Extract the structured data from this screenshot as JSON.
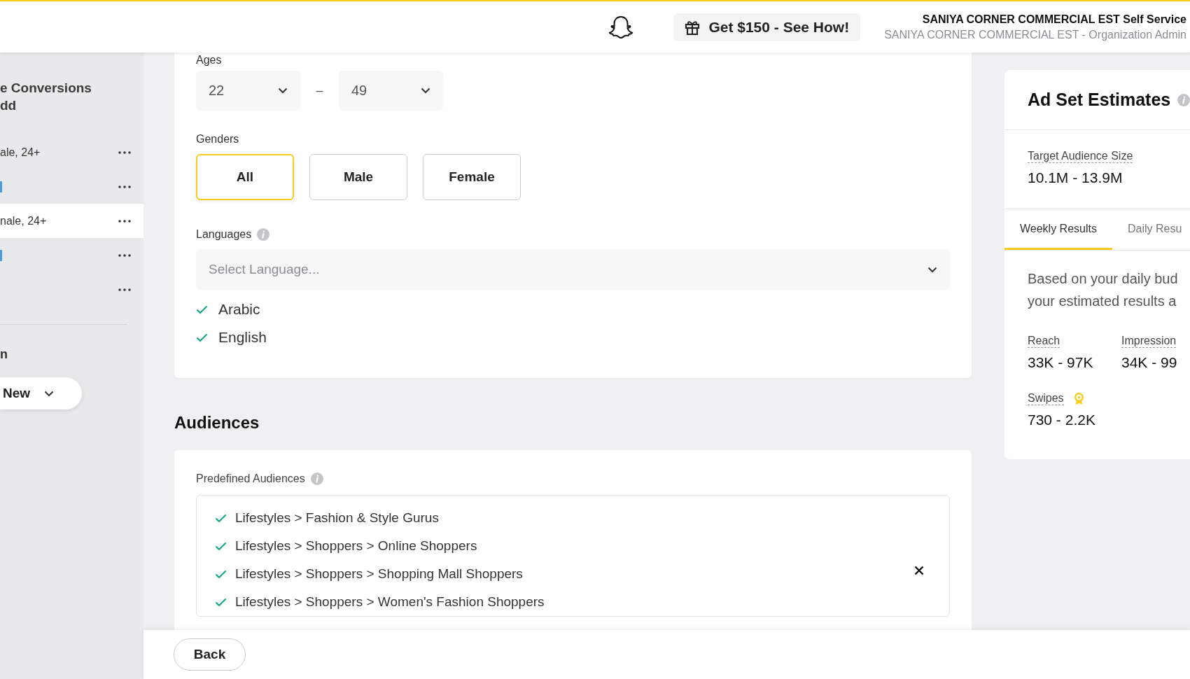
{
  "header": {
    "promo_button": "Get $150 - See How!",
    "account_name": "SANIYA CORNER COMMERCIAL EST Self Service",
    "account_role": "SANIYA CORNER COMMERCIAL EST - Organization Admin"
  },
  "sidebar": {
    "campaign_title": [
      "e Conversions",
      "dd"
    ],
    "ad_sets": [
      {
        "kind": "text",
        "label": "ale, 24+",
        "selected": false
      },
      {
        "kind": "link",
        "selected": false
      },
      {
        "kind": "text",
        "label": "nale, 24+",
        "selected": true
      },
      {
        "kind": "link",
        "selected": false
      },
      {
        "kind": "empty",
        "selected": false
      }
    ],
    "section_label": "n",
    "new_button": "New"
  },
  "demographics": {
    "ages_label": "Ages",
    "age_min": "22",
    "age_max": "49",
    "range_separator": "–",
    "genders_label": "Genders",
    "genders": [
      {
        "label": "All",
        "selected": true
      },
      {
        "label": "Male",
        "selected": false
      },
      {
        "label": "Female",
        "selected": false
      }
    ],
    "languages_label": "Languages",
    "language_placeholder": "Select Language...",
    "languages": [
      {
        "label": "Arabic",
        "checked": true
      },
      {
        "label": "English",
        "checked": true
      }
    ]
  },
  "audiences": {
    "heading": "Audiences",
    "predefined_label": "Predefined Audiences",
    "items": [
      {
        "label": "Lifestyles > Fashion & Style Gurus",
        "checked": true
      },
      {
        "label": "Lifestyles > Shoppers > Online Shoppers",
        "checked": true
      },
      {
        "label": "Lifestyles > Shoppers > Shopping Mall Shoppers",
        "checked": true
      },
      {
        "label": "Lifestyles > Shoppers > Women's Fashion Shoppers",
        "checked": true
      }
    ]
  },
  "estimates": {
    "title": "Ad Set Estimates",
    "audience_size_label": "Target Audience Size",
    "audience_size": "10.1M - 13.9M",
    "tabs": [
      {
        "label": "Weekly Results",
        "selected": true
      },
      {
        "label": "Daily Resu",
        "selected": false
      }
    ],
    "description": [
      "Based on your daily bud",
      "your estimated results a"
    ],
    "metrics": [
      {
        "label": "Reach",
        "value": "33K - 97K",
        "badge": false
      },
      {
        "label": "Impression",
        "value": "34K - 99",
        "badge": false
      },
      {
        "label": "Swipes",
        "value": "730 - 2.2K",
        "badge": true
      }
    ]
  },
  "footer": {
    "back_button": "Back"
  }
}
